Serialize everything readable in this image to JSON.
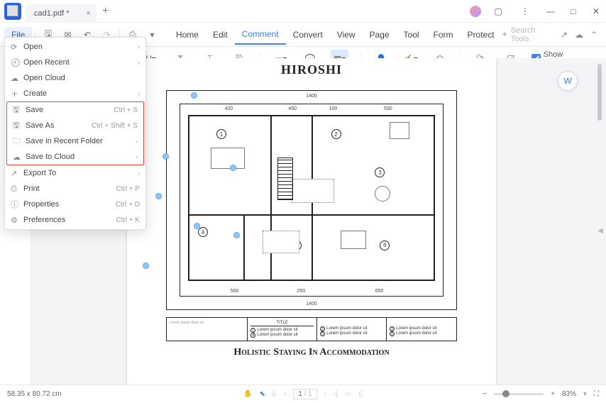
{
  "titlebar": {
    "tab": "cad1.pdf *"
  },
  "menubar": {
    "file": "File",
    "items": [
      "Home",
      "Edit",
      "Comment",
      "Convert",
      "View",
      "Page",
      "Tool",
      "Form",
      "Protect"
    ],
    "active": "Comment",
    "search_placeholder": "Search Tools"
  },
  "toolbar": {
    "show_comment": "Show Comment"
  },
  "filemenu": {
    "groups": [
      [
        {
          "icon": "⟳",
          "label": "Open",
          "arrow": true
        },
        {
          "icon": "🕘",
          "label": "Open Recent",
          "arrow": true
        },
        {
          "icon": "☁",
          "label": "Open Cloud"
        },
        {
          "icon": "＋",
          "label": "Create",
          "arrow": true
        }
      ],
      [
        {
          "icon": "🖫",
          "label": "Save",
          "shortcut": "Ctrl + S"
        },
        {
          "icon": "🖫",
          "label": "Save As",
          "shortcut": "Ctrl + Shift + S"
        },
        {
          "icon": "🗀",
          "label": "Save in Recent Folder",
          "arrow": true
        },
        {
          "icon": "☁",
          "label": "Save to Cloud",
          "arrow": true
        }
      ],
      [
        {
          "icon": "↗",
          "label": "Export To",
          "arrow": true
        },
        {
          "icon": "⎙",
          "label": "Print",
          "shortcut": "Ctrl + P"
        },
        {
          "icon": "ⓘ",
          "label": "Properties",
          "shortcut": "Ctrl + D"
        },
        {
          "icon": "⚙",
          "label": "Preferences",
          "shortcut": "Ctrl + K"
        }
      ]
    ]
  },
  "document": {
    "heading": "HIROSHI",
    "caption": "Holistic Staying In Accommodation",
    "dim_top": "1400",
    "dim_bot": "1400",
    "dims_row": [
      "420",
      "450",
      "100",
      "530"
    ],
    "dims_row2": [
      "500",
      "250",
      "650"
    ],
    "legend_title": "TITLE",
    "legend_text": "Lorem ipsum dolor sit",
    "rooms": [
      "1",
      "2",
      "3",
      "4",
      "5",
      "6"
    ]
  },
  "status": {
    "coords": "58.35 x 80.72 cm",
    "page": "1",
    "pages": "/ 1",
    "zoom": "83%"
  }
}
